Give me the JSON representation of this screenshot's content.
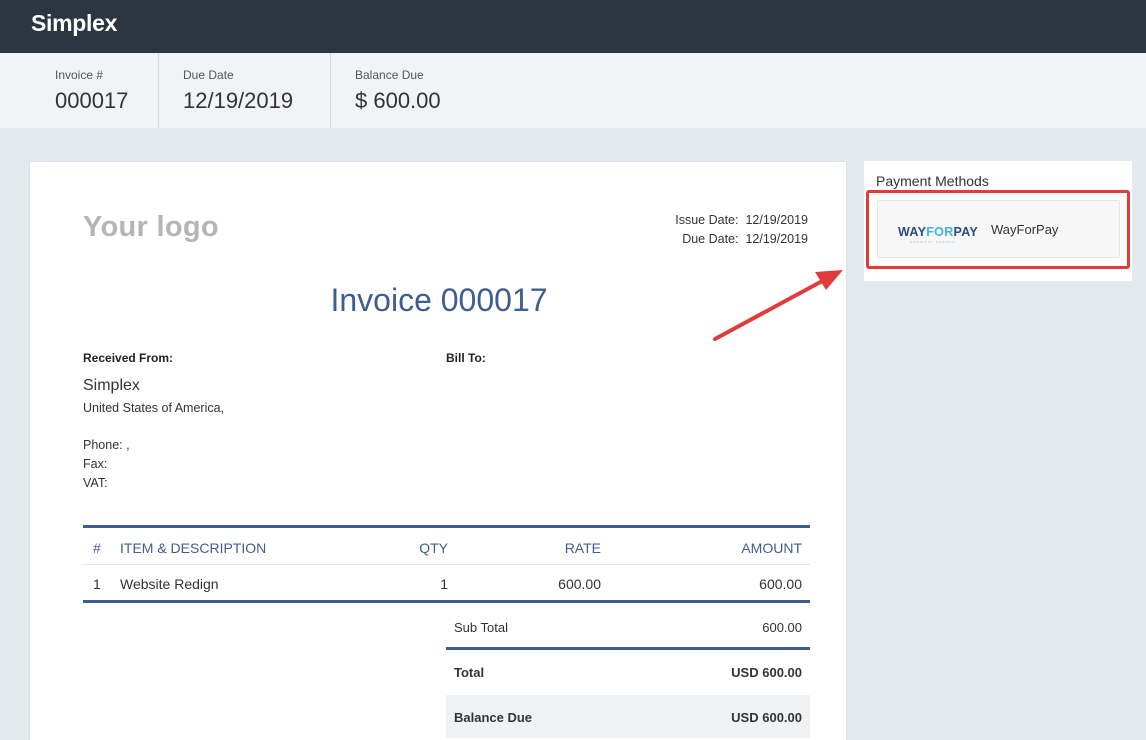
{
  "app": {
    "title": "Simplex"
  },
  "summary": {
    "invoice_label": "Invoice #",
    "invoice_value": "000017",
    "due_label": "Due Date",
    "due_value": "12/19/2019",
    "balance_label": "Balance Due",
    "balance_value": "$ 600.00"
  },
  "invoice": {
    "logo_text": "Your logo",
    "issue_date_label": "Issue Date:",
    "issue_date": "12/19/2019",
    "due_date_label": "Due Date:",
    "due_date": "12/19/2019",
    "title": "Invoice 000017",
    "received_from_label": "Received From:",
    "bill_to_label": "Bill To:",
    "from_name": "Simplex",
    "from_country": "United States of America,",
    "phone": "Phone: ,",
    "fax": "Fax:",
    "vat": "VAT:"
  },
  "items": {
    "headers": {
      "num": "#",
      "desc": "ITEM & DESCRIPTION",
      "qty": "QTY",
      "rate": "RATE",
      "amount": "AMOUNT"
    },
    "rows": [
      {
        "num": "1",
        "desc": "Website Redign",
        "qty": "1",
        "rate": "600.00",
        "amount": "600.00"
      }
    ]
  },
  "totals": {
    "subtotal_label": "Sub Total",
    "subtotal_value": "600.00",
    "total_label": "Total",
    "total_value": "USD 600.00",
    "balance_label": "Balance Due",
    "balance_value": "USD 600.00"
  },
  "payment": {
    "title": "Payment Methods",
    "logo_part1": "WAY",
    "logo_part2": "FOR",
    "logo_part3": "PAY",
    "logo_sub": "payment system",
    "method_name": "WayForPay"
  },
  "colors": {
    "topbar": "#2c3542",
    "accent": "#3f5d8f",
    "highlight": "#e03c3c"
  }
}
